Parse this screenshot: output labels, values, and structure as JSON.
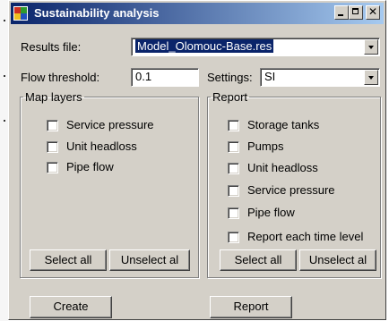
{
  "window": {
    "title": "Sustainability analysis"
  },
  "results_file": {
    "label": "Results file:",
    "value": "Model_Olomouc-Base.res"
  },
  "flow_threshold": {
    "label": "Flow threshold:",
    "value": "0.1"
  },
  "settings": {
    "label": "Settings:",
    "value": "SI"
  },
  "map_layers": {
    "title": "Map layers",
    "items": [
      "Service pressure",
      "Unit headloss",
      "Pipe flow"
    ],
    "select_all": "Select all",
    "unselect_all": "Unselect al"
  },
  "report": {
    "title": "Report",
    "items": [
      "Storage tanks",
      "Pumps",
      "Unit headloss",
      "Service pressure",
      "Pipe flow"
    ],
    "each_time_level": "Report each time level",
    "select_all": "Select all",
    "unselect_all": "Unselect al"
  },
  "buttons": {
    "create": "Create",
    "report": "Report"
  },
  "colors": {
    "title_start": "#0a246a",
    "title_end": "#a6caf0",
    "face": "#d4d0c8"
  }
}
